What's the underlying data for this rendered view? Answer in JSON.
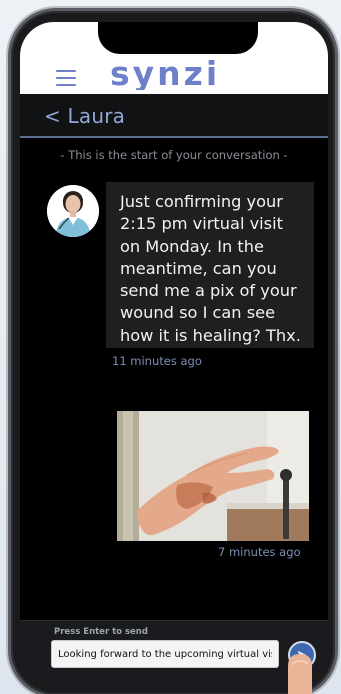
{
  "app": {
    "logo_text": "synzi"
  },
  "conversation": {
    "back_label": "< Laura",
    "start_note": "- This is the start of your conversation -"
  },
  "messages": [
    {
      "type": "text",
      "text": "Just confirming your\n2:15 pm virtual visit\non Monday.  In the\nmeantime, can you\nsend me a pix of your\nwound so I can see\nhow it is healing?  Thx.",
      "time": "11 minutes ago"
    },
    {
      "type": "image",
      "time": "7 minutes ago"
    }
  ],
  "composer": {
    "hint": "Press Enter to send",
    "value": "Looking forward to the upcoming virtual visit"
  },
  "colors": {
    "accent": "#6e80c9",
    "send_button": "#3d67b0",
    "back_link": "#8ea9d6"
  }
}
